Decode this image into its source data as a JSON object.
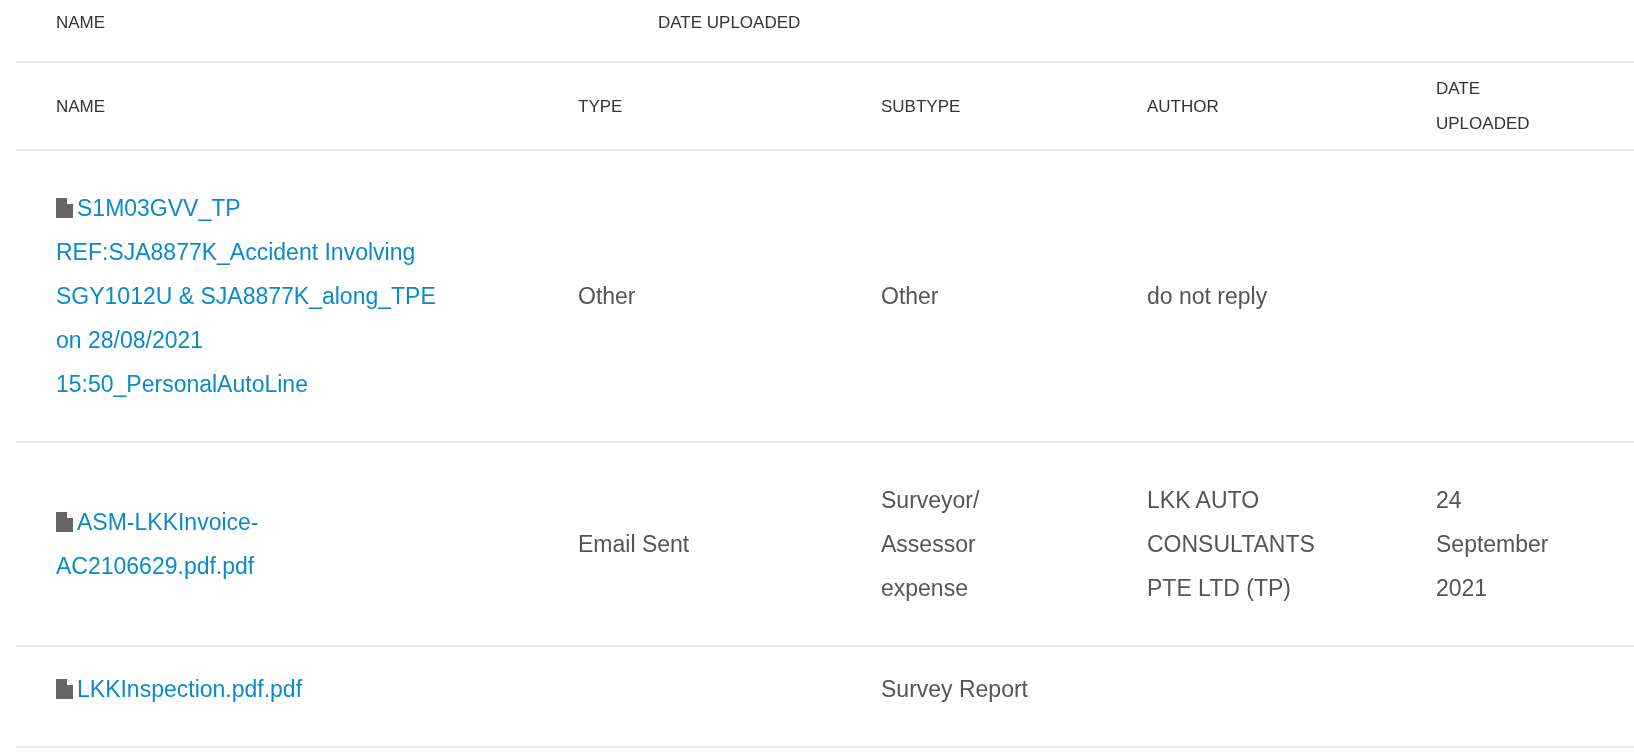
{
  "top_header": {
    "columns": [
      "NAME",
      "DATE UPLOADED"
    ]
  },
  "table": {
    "columns": [
      "NAME",
      "TYPE",
      "SUBTYPE",
      "AUTHOR",
      "DATE UPLOADED"
    ],
    "rows": [
      {
        "name": "S1M03GVV_TP REF:SJA8877K_Accident Involving SGY1012U & SJA8877K_along_TPE on 28/08/2021 15:50_PersonalAutoLine",
        "type": "Other",
        "subtype": "Other",
        "author": "do not reply"
      },
      {
        "name": "ASM-LKKInvoice-AC2106629.pdf.pdf",
        "type": "Email Sent",
        "subtype": "Surveyor/ Assessor expense",
        "author": "LKK AUTO CONSULTANTS PTE LTD (TP)",
        "date": "24 September 2021"
      },
      {
        "name": "LKKInspection.pdf.pdf",
        "subtype": "Survey Report"
      }
    ]
  }
}
